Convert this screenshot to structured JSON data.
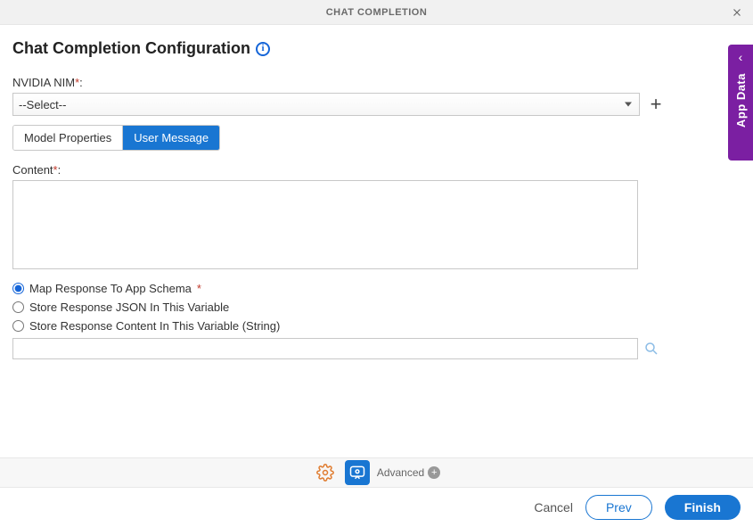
{
  "titlebar": {
    "title": "CHAT COMPLETION"
  },
  "page": {
    "title": "Chat Completion Configuration"
  },
  "nim": {
    "label": "NVIDIA NIM",
    "selected": "--Select--"
  },
  "tabs": {
    "model_properties": "Model Properties",
    "user_message": "User Message"
  },
  "contentField": {
    "label": "Content",
    "value": ""
  },
  "radios": {
    "map_schema": "Map Response To App Schema",
    "store_json": "Store Response JSON In This Variable",
    "store_string": "Store Response Content In This Variable (String)"
  },
  "mapper": {
    "value": ""
  },
  "footer": {
    "advanced": "Advanced"
  },
  "buttons": {
    "cancel": "Cancel",
    "prev": "Prev",
    "finish": "Finish"
  },
  "sidetab": {
    "label": "App Data"
  }
}
